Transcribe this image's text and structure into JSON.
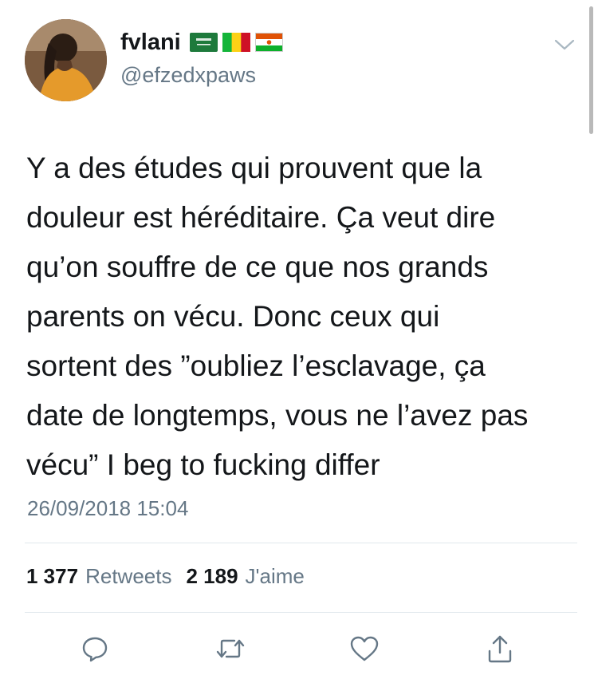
{
  "user": {
    "display_name": "fvlani",
    "handle": "@efzedxpaws",
    "flags": [
      "saudi-arabia-flag",
      "mali-flag",
      "niger-flag"
    ]
  },
  "tweet": {
    "lines": [
      "Y a des études qui prouvent que la",
      "douleur est héréditaire. Ça veut dire",
      "qu’on souffre de ce que nos grands",
      "parents on vécu. Donc ceux qui",
      "sortent des ”oubliez l’esclavage, ça",
      "date de longtemps, vous ne l’avez pas",
      "vécu” I beg to fucking differ"
    ],
    "timestamp": "26/09/2018 15:04"
  },
  "stats": {
    "retweets_count": "1 377",
    "retweets_label": "Retweets",
    "likes_count": "2 189",
    "likes_label": "J'aime"
  },
  "actions": [
    "reply-icon",
    "retweet-icon",
    "like-icon",
    "share-icon"
  ],
  "colors": {
    "text": "#14171a",
    "secondary": "#657786",
    "divider": "#e1e8ed"
  }
}
